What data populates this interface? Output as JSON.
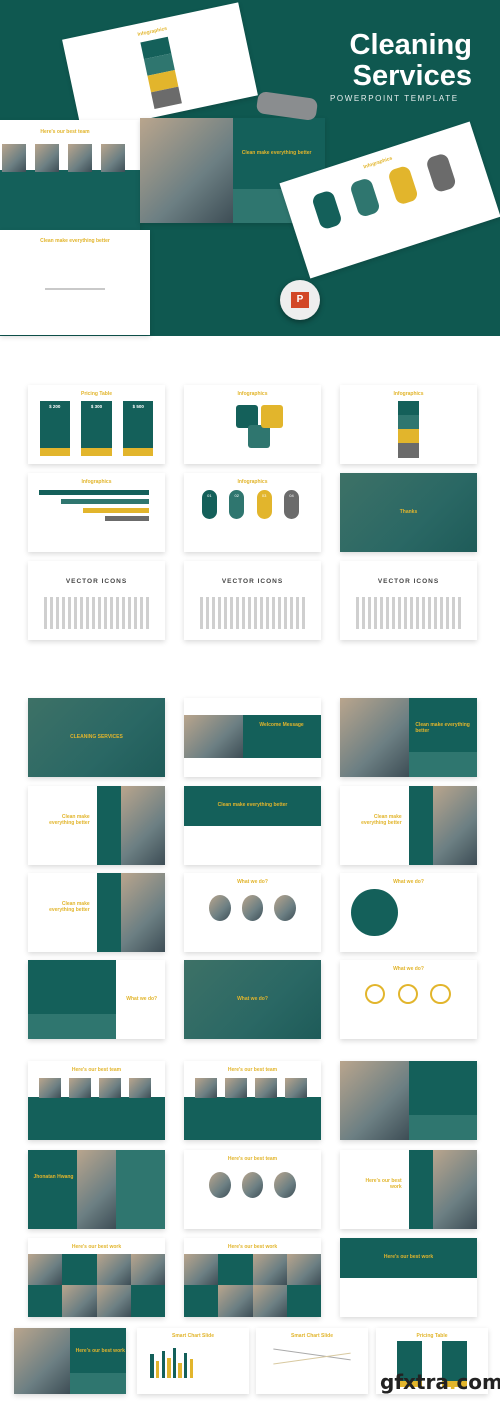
{
  "header": {
    "title_line1": "Cleaning",
    "title_line2": "Services",
    "subtitle": "POWERPOINT TEMPLATE"
  },
  "colors": {
    "teal": "#14605a",
    "dark_teal": "#0f5850",
    "yellow": "#e2b52c",
    "gray": "#6b6b6b"
  },
  "hero_slides": [
    {
      "title": "Infographics",
      "kind": "infographic"
    },
    {
      "title": "Here's our best team",
      "kind": "team"
    },
    {
      "title": "Clean make everything better",
      "kind": "split"
    },
    {
      "title": "Infographics",
      "kind": "steps"
    },
    {
      "title": "Clean make everything better",
      "kind": "light"
    }
  ],
  "hero_badge": "P",
  "grid1": [
    {
      "title": "Pricing Table",
      "kind": "pricing",
      "prices": [
        "$ 200",
        "$ 300",
        "$ 500"
      ]
    },
    {
      "title": "Infographics",
      "kind": "puzzle"
    },
    {
      "title": "Infographics",
      "kind": "infographic"
    },
    {
      "title": "Infographics",
      "kind": "arrows"
    },
    {
      "title": "Infographics",
      "kind": "steps",
      "steps": [
        "01",
        "02",
        "03",
        "04"
      ]
    },
    {
      "title": "Thanks",
      "kind": "dark"
    },
    {
      "title": "VECTOR ICONS",
      "kind": "vec"
    },
    {
      "title": "VECTOR ICONS",
      "kind": "vec"
    },
    {
      "title": "VECTOR ICONS",
      "kind": "vec"
    }
  ],
  "grid2": [
    {
      "title": "CLEANING SERVICES",
      "kind": "dark"
    },
    {
      "title": "Welcome Message",
      "kind": "welcome"
    },
    {
      "title": "Clean make everything better",
      "kind": "split"
    },
    {
      "title": "Clean make everything better",
      "kind": "leftphoto"
    },
    {
      "title": "Clean make everything better",
      "kind": "banner"
    },
    {
      "title": "Clean make everything better",
      "kind": "leftphoto"
    },
    {
      "title": "Clean make everything better",
      "kind": "leftphoto"
    },
    {
      "title": "What we do?",
      "kind": "circles"
    },
    {
      "title": "What we do?",
      "kind": "bigcircle"
    },
    {
      "title": "What we do?",
      "kind": "leftpanel"
    },
    {
      "title": "What we do?",
      "kind": "dark"
    },
    {
      "title": "What we do?",
      "kind": "rings"
    },
    {
      "title": "Here's our best team",
      "kind": "team"
    },
    {
      "title": "Here's our best team",
      "kind": "team"
    },
    {
      "title": "",
      "kind": "split"
    },
    {
      "title": "Jhonatan Hwang",
      "kind": "profile"
    },
    {
      "title": "Here's our best team",
      "kind": "circles"
    },
    {
      "title": "Here's our best work",
      "kind": "leftphoto"
    },
    {
      "title": "Here's our best work",
      "kind": "mosaic"
    },
    {
      "title": "Here's our best work",
      "kind": "mosaic"
    },
    {
      "title": "Here's our best work",
      "kind": "banner"
    }
  ],
  "grid3": [
    {
      "title": "Here's our best work",
      "kind": "split"
    },
    {
      "title": "Smart Chart Slide",
      "kind": "chart"
    },
    {
      "title": "Smart Chart Slide",
      "kind": "line"
    },
    {
      "title": "Pricing Table",
      "kind": "pricing",
      "prices": [
        "",
        ""
      ]
    }
  ],
  "watermark": {
    "main": "gfxtra",
    "dot": ".",
    "tld": "com"
  }
}
